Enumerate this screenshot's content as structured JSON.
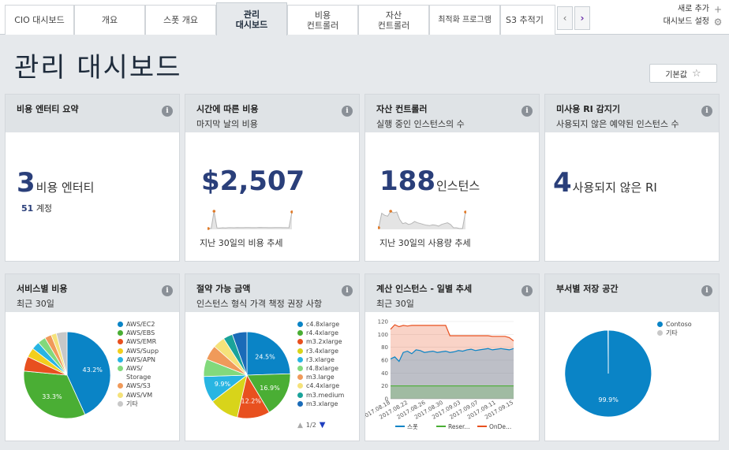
{
  "tabs": [
    {
      "label": "CIO 대시보드",
      "active": false
    },
    {
      "label": "개요",
      "active": false
    },
    {
      "label": "스폿 개요",
      "active": false
    },
    {
      "label": "관리\n대시보드",
      "active": true
    },
    {
      "label": "비용\n컨트롤러",
      "active": false
    },
    {
      "label": "자산\n컨트롤러",
      "active": false
    },
    {
      "label": "최적화 프로그램",
      "active": false
    },
    {
      "label": "S3 추적기",
      "active": false
    }
  ],
  "tab_scroll": {
    "left_icon": "chevron-left",
    "right_icon": "chevron-right",
    "left": "‹",
    "right": "›"
  },
  "actions": {
    "add_new": "새로 추가",
    "dashboard_settings": "대시보드 설정",
    "add_glyph": "+",
    "gear_glyph": "⚙"
  },
  "page": {
    "title": "관리 대시보드",
    "default_button": "기본값",
    "pin_glyph": "☆"
  },
  "info_glyph": "i",
  "cards": {
    "cost_entity": {
      "title": "비용 엔터티 요약",
      "subtitle": "",
      "value": "3",
      "unit": "비용 엔터티",
      "accounts_num": "51",
      "accounts_label": "계정"
    },
    "cost_over_time": {
      "title": "시간에 따른 비용",
      "subtitle": "마지막 날의 비용",
      "value": "$2,507",
      "caption": "지난 30일의 비용 추세"
    },
    "asset_controller": {
      "title": "자산 컨트롤러",
      "subtitle": "실행 중인 인스턴스의 수",
      "value": "188",
      "unit": "인스턴스",
      "caption": "지난 30일의 사용량 추세"
    },
    "unused_ri": {
      "title": "미사용 RI 감지기",
      "subtitle": "사용되지 않은 예약된 인스턴스 수",
      "value": "4",
      "unit": "사용되지 않은 RI"
    },
    "service_cost": {
      "title": "서비스별 비용",
      "subtitle": "최근 30일"
    },
    "savings": {
      "title": "절약 가능 금액",
      "subtitle": "인스턴스 형식 가격 책정 권장 사항",
      "pager": "1/2",
      "up": "▲",
      "down": "▼"
    },
    "compute_daily": {
      "title": "계산 인스턴스 - 일별 추세",
      "subtitle": "최근 30일"
    },
    "storage_dept": {
      "title": "부서별 저장 공간",
      "subtitle": ""
    }
  },
  "chart_data": [
    {
      "type": "line",
      "title": "시간에 따른 비용",
      "series": [
        {
          "values": [
            300,
            320,
            2600,
            380,
            360,
            400,
            380,
            420,
            410,
            400,
            430,
            410,
            420,
            440,
            430,
            420,
            410,
            430,
            450,
            440,
            430,
            420,
            410,
            430,
            440,
            430,
            420,
            410,
            400,
            2507
          ]
        }
      ],
      "color": "#e07b2a"
    },
    {
      "type": "line",
      "title": "자산 컨트롤러",
      "series": [
        {
          "values": [
            150,
            185,
            180,
            178,
            190,
            186,
            188,
            170,
            160,
            162,
            158,
            160,
            165,
            162,
            160,
            158,
            156,
            155,
            157,
            156,
            154,
            158,
            160,
            162,
            158,
            150,
            150,
            148,
            148,
            188
          ]
        }
      ],
      "color": "#e07b2a"
    },
    {
      "type": "pie",
      "title": "서비스별 비용",
      "categories": [
        "AWS/EC2",
        "AWS/EBS",
        "AWS/EMR",
        "AWS/Supp",
        "AWS/APN",
        "AWS/\nStorage",
        "AWS/S3",
        "AWS/VM",
        "기타"
      ],
      "values": [
        43.2,
        33.3,
        5.5,
        3.5,
        3.0,
        3.0,
        2.5,
        2.0,
        4.0
      ],
      "labels": [
        "43.2%",
        "33.3%",
        "",
        "",
        "",
        "",
        "",
        "",
        ""
      ],
      "colors": [
        "#0a84c6",
        "#4aae34",
        "#e8501f",
        "#f2cf1d",
        "#28b5e2",
        "#82d97c",
        "#f09a5a",
        "#f5e27a",
        "#c8c8c8"
      ]
    },
    {
      "type": "pie",
      "title": "절약 가능 금액",
      "categories": [
        "c4.8xlarge",
        "r4.4xlarge",
        "m3.2xlarge",
        "r3.4xlarge",
        "r3.xlarge",
        "r4.8xlarge",
        "m3.large",
        "c4.4xlarge",
        "m3.medium",
        "m3.xlarge"
      ],
      "values": [
        24.5,
        16.9,
        12.2,
        11.0,
        9.9,
        6.5,
        5.5,
        4.5,
        3.5,
        5.5
      ],
      "labels": [
        "24.5%",
        "16.9%",
        "12.2%",
        "",
        "9.9%",
        "",
        "",
        "",
        "",
        ""
      ],
      "colors": [
        "#0a84c6",
        "#4aae34",
        "#e8501f",
        "#d8d41a",
        "#28b5e2",
        "#82d97c",
        "#f09a5a",
        "#f5e27a",
        "#1aa39a",
        "#1a6bb8"
      ]
    },
    {
      "type": "area",
      "title": "계산 인스턴스 - 일별 추세",
      "x": [
        "2017.08.18",
        "2017.08.22",
        "2017.08.26",
        "2017.08.30",
        "2017.09.03",
        "2017.09.07",
        "2017.09.11",
        "2017.09.15"
      ],
      "ylim": [
        0,
        120
      ],
      "yticks": [
        0,
        20,
        40,
        60,
        80,
        100,
        120
      ],
      "series": [
        {
          "name": "스폿",
          "values": [
            62,
            65,
            58,
            72,
            74,
            70,
            76,
            75,
            72,
            73,
            74,
            72,
            73,
            74,
            72,
            73,
            75,
            74,
            76,
            77,
            75,
            76,
            77,
            78,
            76,
            77,
            78,
            77,
            76,
            78
          ],
          "color": "#0a84c6"
        },
        {
          "name": "Reser...",
          "values": [
            20,
            20,
            20,
            20,
            20,
            20,
            20,
            20,
            20,
            20,
            20,
            20,
            20,
            20,
            20,
            20,
            20,
            20,
            20,
            20,
            20,
            20,
            20,
            20,
            20,
            20,
            20,
            20,
            20,
            20
          ],
          "color": "#4aae34"
        },
        {
          "name": "OnDe...",
          "values": [
            108,
            115,
            112,
            114,
            113,
            114,
            114,
            114,
            114,
            114,
            114,
            114,
            114,
            114,
            98,
            98,
            98,
            98,
            98,
            98,
            98,
            98,
            98,
            98,
            97,
            97,
            97,
            97,
            95,
            90
          ],
          "color": "#e8501f"
        }
      ]
    },
    {
      "type": "pie",
      "title": "부서별 저장 공간",
      "categories": [
        "Contoso",
        "기타"
      ],
      "values": [
        99.9,
        0.1
      ],
      "labels": [
        "99.9%",
        ""
      ],
      "colors": [
        "#0a84c6",
        "#c8c8c8"
      ]
    }
  ]
}
